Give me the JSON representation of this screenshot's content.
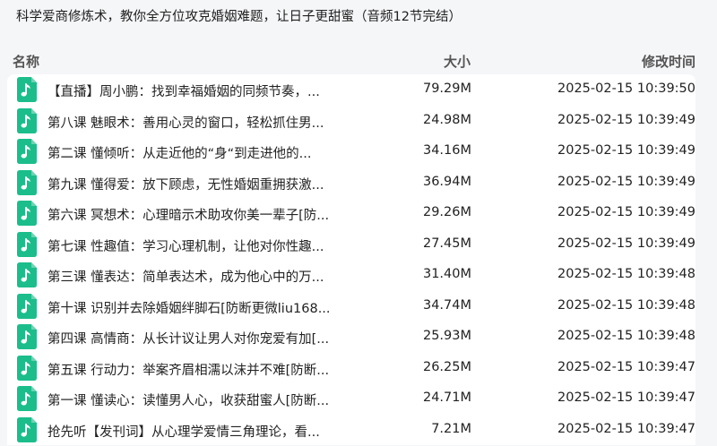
{
  "title": "科学爱商修炼术，教你全方位攻克婚姻难题，让日子更甜蜜（音频12节完结）",
  "columns": {
    "name": "名称",
    "size": "大小",
    "time": "修改时间"
  },
  "colors": {
    "file_icon": "#1bbd8b",
    "background": "#f5f6f8",
    "list_background": "#ffffff"
  },
  "file_icon_name": "music-file-icon",
  "files": [
    {
      "name": "【直播】周小鹏：找到幸福婚姻的同频节奏，...",
      "size": "79.29M",
      "time": "2025-02-15 10:39:50"
    },
    {
      "name": "第八课 魅眼术：善用心灵的窗口，轻松抓住男...",
      "size": "24.98M",
      "time": "2025-02-15 10:39:49"
    },
    {
      "name": "第二课 懂倾听：从走近他的“身“到走进他的...",
      "size": "34.16M",
      "time": "2025-02-15 10:39:49"
    },
    {
      "name": "第九课 懂得爱：放下顾虑，无性婚姻重拥获激...",
      "size": "36.94M",
      "time": "2025-02-15 10:39:49"
    },
    {
      "name": "第六课 冥想术：心理暗示术助攻你美一辈子[防...",
      "size": "29.26M",
      "time": "2025-02-15 10:39:49"
    },
    {
      "name": "第七课 性趣值：学习心理机制，让他对你性趣...",
      "size": "27.45M",
      "time": "2025-02-15 10:39:49"
    },
    {
      "name": "第三课 懂表达：简单表达术，成为他心中的万...",
      "size": "31.40M",
      "time": "2025-02-15 10:39:48"
    },
    {
      "name": "第十课 识别并去除婚姻绊脚石[防断更微liu168...",
      "size": "34.74M",
      "time": "2025-02-15 10:39:48"
    },
    {
      "name": "第四课 高情商：从长计议让男人对你宠爱有加[...",
      "size": "25.93M",
      "time": "2025-02-15 10:39:48"
    },
    {
      "name": "第五课 行动力：举案齐眉相濡以沫并不难[防断...",
      "size": "26.25M",
      "time": "2025-02-15 10:39:47"
    },
    {
      "name": "第一课 懂读心：读懂男人心，收获甜蜜人[防断...",
      "size": "24.71M",
      "time": "2025-02-15 10:39:47"
    },
    {
      "name": "抢先听【发刊词】从心理学爱情三角理论，看...",
      "size": "7.21M",
      "time": "2025-02-15 10:39:47"
    }
  ]
}
